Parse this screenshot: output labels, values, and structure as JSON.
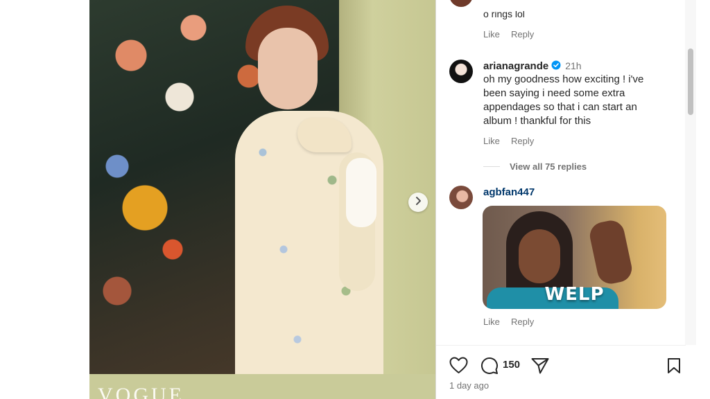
{
  "post": {
    "image_caption": "VOGUE",
    "next_icon": "chevron-right-icon"
  },
  "comments": {
    "top_partial_text": "o rings lol",
    "top_actions": {
      "like": "Like",
      "reply": "Reply"
    },
    "main": {
      "username": "arianagrande",
      "verified_icon": "verified-badge-icon",
      "time": "21h",
      "lines": [
        "oh my goodness how exciting ! i've",
        "been saying i need some extra",
        "appendages so that i can start an",
        "album ! thankful for this"
      ],
      "like": "Like",
      "reply": "Reply",
      "view_replies": "View all 75 replies"
    },
    "second": {
      "username": "agbfan447",
      "gif_text": "WELP",
      "like": "Like",
      "reply": "Reply"
    }
  },
  "footer": {
    "like_icon": "heart-icon",
    "comment_icon": "comment-icon",
    "comment_count": "150",
    "share_icon": "share-icon",
    "save_icon": "bookmark-icon",
    "time_ago": "1 day ago"
  },
  "colors": {
    "text": "#262626",
    "muted": "#737373",
    "verified": "#0095f6",
    "link_username": "#00376b"
  }
}
